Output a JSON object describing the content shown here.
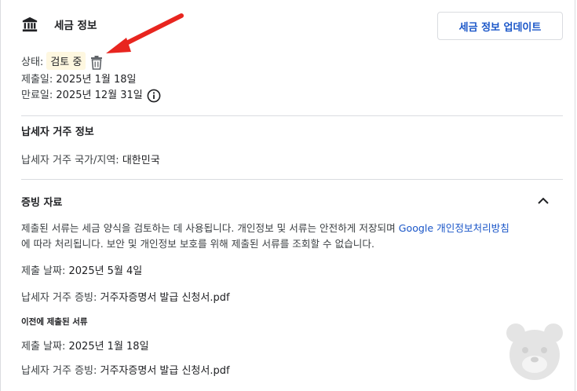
{
  "tax_info": {
    "title": "세금 정보",
    "update_button": "세금 정보 업데이트",
    "status_label": "상태:",
    "status_value": "검토 중",
    "submitted_label": "제출일:",
    "submitted_value": "2025년 1월 18일",
    "expiry_label": "만료일:",
    "expiry_value": "2025년 12월 31일"
  },
  "residency": {
    "title": "납세자 거주 정보",
    "country_label": "납세자 거주 국가/지역:",
    "country_value": "대한민국"
  },
  "evidence": {
    "title": "증빙 자료",
    "description_1": "제출된 서류는 세금 양식을 검토하는 데 사용됩니다. 개인정보 및 서류는 안전하게 저장되며",
    "privacy_link": "Google 개인정보처리방침",
    "description_2": "에 따라 처리됩니다. 보안 및 개인정보 보호를 위해 제출된 서류를 조회할 수 없습니다.",
    "current_date_label": "제출 날짜:",
    "current_date_value": "2025년 5월 4일",
    "current_doc_label": "납세자 거주 증빙:",
    "current_doc_value": "거주자증명서 발급 신청서.pdf",
    "previous_title": "이전에 제출된 서류",
    "previous_date_label": "제출 날짜:",
    "previous_date_value": "2025년 1월 18일",
    "previous_doc_label": "납세자 거주 증빙:",
    "previous_doc_value": "거주자증명서 발급 신청서.pdf"
  },
  "icons": {
    "bank": "bank-icon",
    "trash": "trash-icon",
    "info": "info-icon",
    "chevron": "chevron-up-icon",
    "arrow": "red-arrow-annotation",
    "watermark": "bear-watermark-icon"
  },
  "colors": {
    "accent_blue": "#1a56c8",
    "badge_bg": "#fef7e0",
    "arrow_red": "#e8251f",
    "divider": "#dadce0"
  }
}
